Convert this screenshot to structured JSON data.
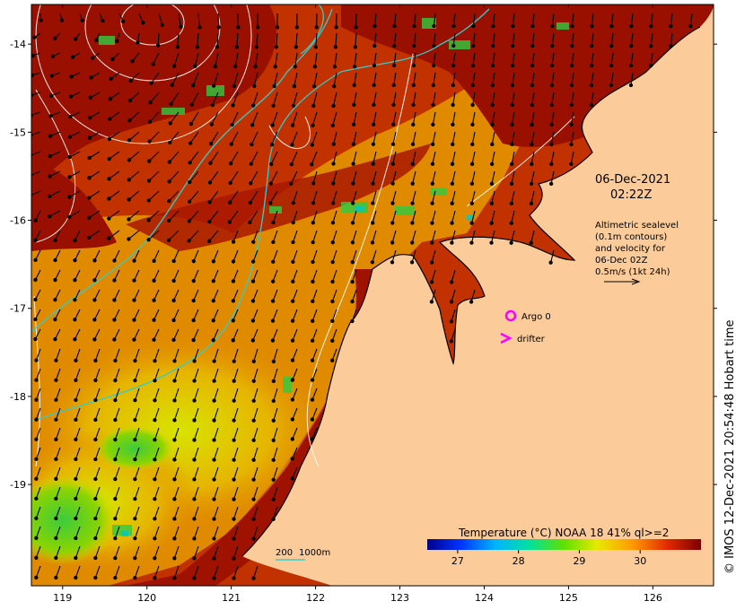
{
  "map": {
    "title": {
      "date": "06-Dec-2021",
      "time": "02:22Z"
    },
    "legend_note": [
      "Altimetric sealevel",
      "(0.1m contours)",
      "and velocity for",
      "06-Dec 02Z",
      "0.5m/s (1kt 24h)"
    ],
    "markers": {
      "argo_label": "Argo 0",
      "drifter_label": "drifter",
      "argo_color": "#ff00ff",
      "drifter_color": "#ff00ff"
    },
    "bathymetry_scale": {
      "label_200": "200",
      "label_1000": "1000m",
      "color": "#33cccc"
    },
    "x_ticks": [
      "119",
      "120",
      "121",
      "122",
      "123",
      "124",
      "125",
      "126"
    ],
    "y_ticks": [
      "-14",
      "-15",
      "-16",
      "-17",
      "-18",
      "-19"
    ],
    "colorbar": {
      "title": "Temperature (°C) NOAA 18 41% ql>=2",
      "ticks": [
        "27",
        "28",
        "29",
        "30"
      ],
      "range": [
        26.5,
        31.0
      ]
    },
    "side_text": "© IMOS 12-Dec-2021 20:54:48 Hobart time",
    "colors": {
      "land": "#fbcb9a",
      "sst_hot": "#9a1000",
      "sst_warm": "#c84a00",
      "sst_mid": "#e69a00",
      "sst_cool": "#e8e000",
      "sst_cold": "#2ecc40",
      "contour": "#ffffff",
      "isobath": "#33cccc"
    }
  }
}
